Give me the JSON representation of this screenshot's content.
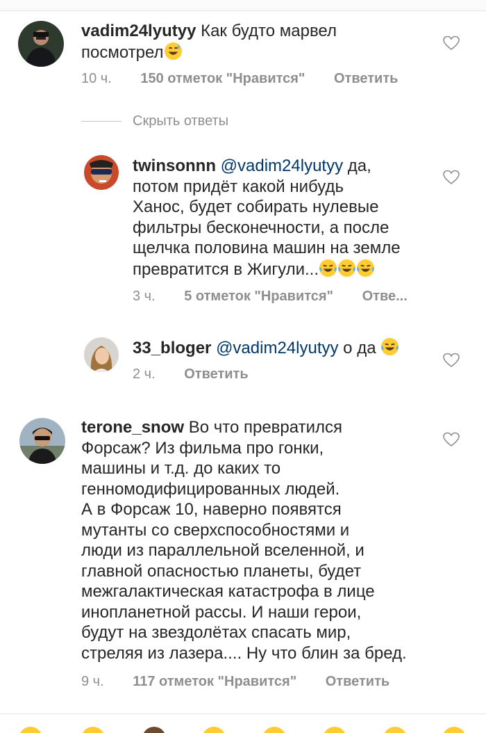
{
  "comments": [
    {
      "username": "vadim24lyutyy",
      "text_line1": "Как будто марвел",
      "text_line2": "посмотрел",
      "time": "10 ч.",
      "likes": "150 отметок \"Нравится\"",
      "reply": "Ответить"
    },
    {
      "username": "twinsonnn",
      "mention": "@vadim24lyutyy",
      "text_line1_after": "да,",
      "lines": [
        "потом придёт какой нибудь",
        "Ханос, будет собирать нулевые",
        "фильтры бесконечности, а после",
        "щелчка половина машин на земле"
      ],
      "last_line": "превратится в Жигули...",
      "time": "3 ч.",
      "likes": "5 отметок \"Нравится\"",
      "reply": "Отве..."
    },
    {
      "username": "33_bloger",
      "mention": "@vadim24lyutyy",
      "text_after": "о да",
      "time": "2 ч.",
      "reply": "Ответить"
    },
    {
      "username": "terone_snow",
      "text_line1": "Во что превратился",
      "lines": [
        "Форсаж? Из фильма про гонки,",
        "машины и т.д. до каких то",
        "генномодифицированных людей.",
        "А в Форсаж 10, наверно появятся",
        "мутанты со сверхспособностями и",
        "люди из параллельной вселенной, и",
        "главной опасностью планеты, будет",
        "межгалактическая катастрофа в лице",
        "инопланетной рассы. И наши герои,",
        "будут на звездолётах спасать мир,",
        "стреляя из лазера.... Ну что блин за бред."
      ],
      "time": "9 ч.",
      "likes": "117 отметок \"Нравится\"",
      "reply": "Ответить"
    }
  ],
  "hide_replies": "Скрыть ответы",
  "icons": {
    "heart": "heart-outline-icon",
    "emoji_sweat_smile": "😅",
    "emoji_tears_joy": "😂"
  },
  "colors": {
    "text": "#262626",
    "meta": "#8e8e8e",
    "mention": "#00376b"
  }
}
